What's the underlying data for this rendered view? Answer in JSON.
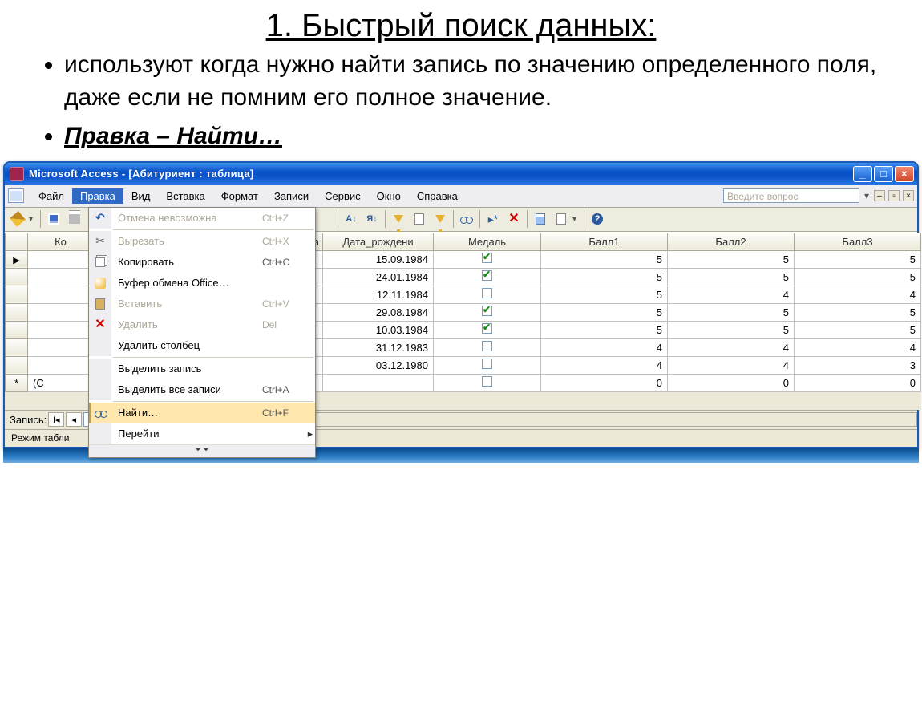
{
  "slide": {
    "title": "1. Быстрый поиск данных:",
    "bullet1": "используют когда нужно найти запись по значению определенного  поля, даже если не помним его полное значение.",
    "bullet2": "Правка – Найти…"
  },
  "window": {
    "title": "Microsoft Access - [Абитуриент : таблица]",
    "ask_placeholder": "Введите вопрос"
  },
  "menus": [
    "Файл",
    "Правка",
    "Вид",
    "Вставка",
    "Формат",
    "Записи",
    "Сервис",
    "Окно",
    "Справка"
  ],
  "dropdown": {
    "items": [
      {
        "label": "Отмена невозможна",
        "shortcut": "Ctrl+Z",
        "disabled": true,
        "icon": "undo"
      },
      {
        "sep": true
      },
      {
        "label": "Вырезать",
        "shortcut": "Ctrl+X",
        "disabled": true,
        "icon": "cut"
      },
      {
        "label": "Копировать",
        "shortcut": "Ctrl+C",
        "disabled": false,
        "icon": "copy"
      },
      {
        "label": "Буфер обмена Office…",
        "shortcut": "",
        "disabled": false,
        "icon": "clip"
      },
      {
        "label": "Вставить",
        "shortcut": "Ctrl+V",
        "disabled": true,
        "icon": "paste"
      },
      {
        "label": "Удалить",
        "shortcut": "Del",
        "disabled": true,
        "icon": "del"
      },
      {
        "label": "Удалить столбец",
        "shortcut": "",
        "disabled": false,
        "icon": ""
      },
      {
        "sep": true
      },
      {
        "label": "Выделить запись",
        "shortcut": "",
        "disabled": false,
        "icon": ""
      },
      {
        "label": "Выделить все записи",
        "shortcut": "Ctrl+A",
        "disabled": false,
        "icon": ""
      },
      {
        "sep": true
      },
      {
        "label": "Найти…",
        "shortcut": "Ctrl+F",
        "disabled": false,
        "icon": "binoc",
        "highlight": true
      },
      {
        "label": "Перейти",
        "shortcut": "",
        "disabled": false,
        "icon": "",
        "submenu": true
      }
    ]
  },
  "grid": {
    "headers": [
      "Ко",
      "а",
      "Дата_рождени",
      "Медаль",
      "Балл1",
      "Балл2",
      "Балл3"
    ],
    "rows": [
      {
        "date": "15.09.1984",
        "medal": true,
        "b1": 5,
        "b2": 5,
        "b3": 5
      },
      {
        "date": "24.01.1984",
        "medal": true,
        "b1": 5,
        "b2": 5,
        "b3": 5
      },
      {
        "date": "12.11.1984",
        "medal": false,
        "b1": 5,
        "b2": 4,
        "b3": 4
      },
      {
        "date": "29.08.1984",
        "medal": true,
        "b1": 5,
        "b2": 5,
        "b3": 5
      },
      {
        "date": "10.03.1984",
        "medal": true,
        "b1": 5,
        "b2": 5,
        "b3": 5
      },
      {
        "date": "31.12.1983",
        "medal": false,
        "b1": 4,
        "b2": 4,
        "b3": 4
      },
      {
        "date": "03.12.1980",
        "medal": false,
        "b1": 4,
        "b2": 4,
        "b3": 3
      }
    ],
    "newrow_placeholder": "(С",
    "newrow_vals": {
      "b1": 0,
      "b2": 0,
      "b3": 0
    }
  },
  "recnav": {
    "label": "Запись:",
    "value": ""
  },
  "statusbar": {
    "text": "Режим табли"
  }
}
